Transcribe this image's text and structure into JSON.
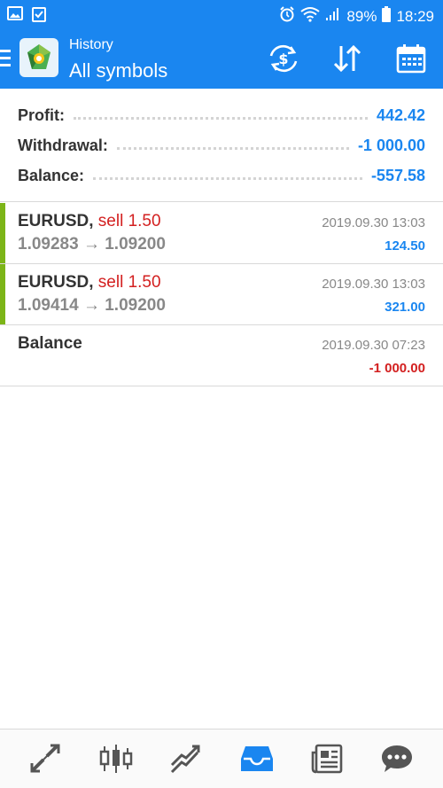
{
  "status_bar": {
    "battery": "89%",
    "time": "18:29"
  },
  "header": {
    "subtitle": "History",
    "title": "All symbols",
    "actions": [
      "currency-exchange-icon",
      "sort-icon",
      "calendar-icon"
    ]
  },
  "summary": [
    {
      "label": "Profit:",
      "value": "442.42"
    },
    {
      "label": "Withdrawal:",
      "value": "-1 000.00"
    },
    {
      "label": "Balance:",
      "value": "-557.58"
    }
  ],
  "deals": [
    {
      "symbol": "EURUSD,",
      "type": "sell 1.50",
      "prices": "1.09283 → 1.09200",
      "time": "2019.09.30 13:03",
      "profit": "124.50",
      "profit_sign": "positive"
    },
    {
      "symbol": "EURUSD,",
      "type": "sell 1.50",
      "prices": "1.09414 → 1.09200",
      "time": "2019.09.30 13:03",
      "profit": "321.00",
      "profit_sign": "positive"
    },
    {
      "symbol": "Balance",
      "type": "",
      "prices": "",
      "time": "2019.09.30 07:23",
      "profit": "-1 000.00",
      "profit_sign": "negative"
    }
  ],
  "bottom_nav": [
    {
      "icon": "quotes-icon",
      "active": false
    },
    {
      "icon": "chart-icon",
      "active": false
    },
    {
      "icon": "trade-icon",
      "active": false
    },
    {
      "icon": "history-icon",
      "active": true
    },
    {
      "icon": "news-icon",
      "active": false
    },
    {
      "icon": "messages-icon",
      "active": false
    }
  ],
  "colors": {
    "accent": "#1a86f0",
    "sell": "#d32020",
    "profit_bar": "#7cb518",
    "inactive_icon": "#555555"
  }
}
